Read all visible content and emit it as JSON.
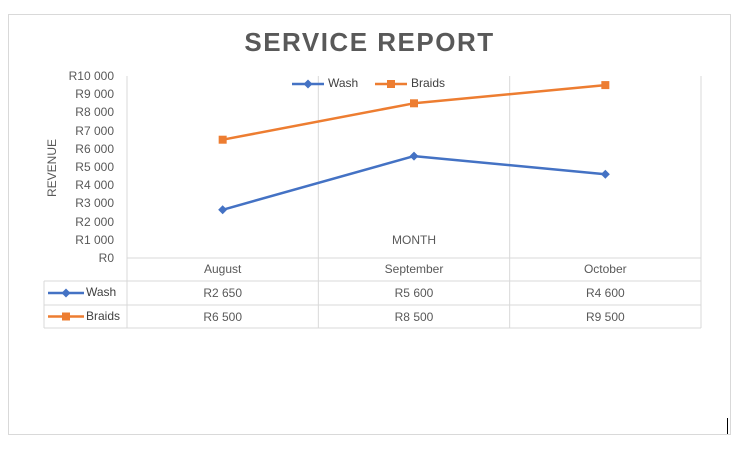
{
  "chart_data": {
    "type": "line",
    "title": "SERVICE REPORT",
    "xlabel": "MONTH",
    "ylabel": "REVENUE",
    "categories": [
      "August",
      "September",
      "October"
    ],
    "ylim": [
      0,
      10000
    ],
    "yticks": [
      "R0",
      "R1 000",
      "R2 000",
      "R3 000",
      "R4 000",
      "R5 000",
      "R6 000",
      "R7 000",
      "R8 000",
      "R9 000",
      "R10 000"
    ],
    "legend_position": "top",
    "data_table": true,
    "series": [
      {
        "name": "Wash",
        "values": [
          2650,
          5600,
          4600
        ],
        "labels": [
          "R2 650",
          "R5 600",
          "R4 600"
        ],
        "color": "#4472c4",
        "marker": "diamond"
      },
      {
        "name": "Braids",
        "values": [
          6500,
          8500,
          9500
        ],
        "labels": [
          "R6 500",
          "R8 500",
          "R9 500"
        ],
        "color": "#ed7d31",
        "marker": "square"
      }
    ]
  }
}
